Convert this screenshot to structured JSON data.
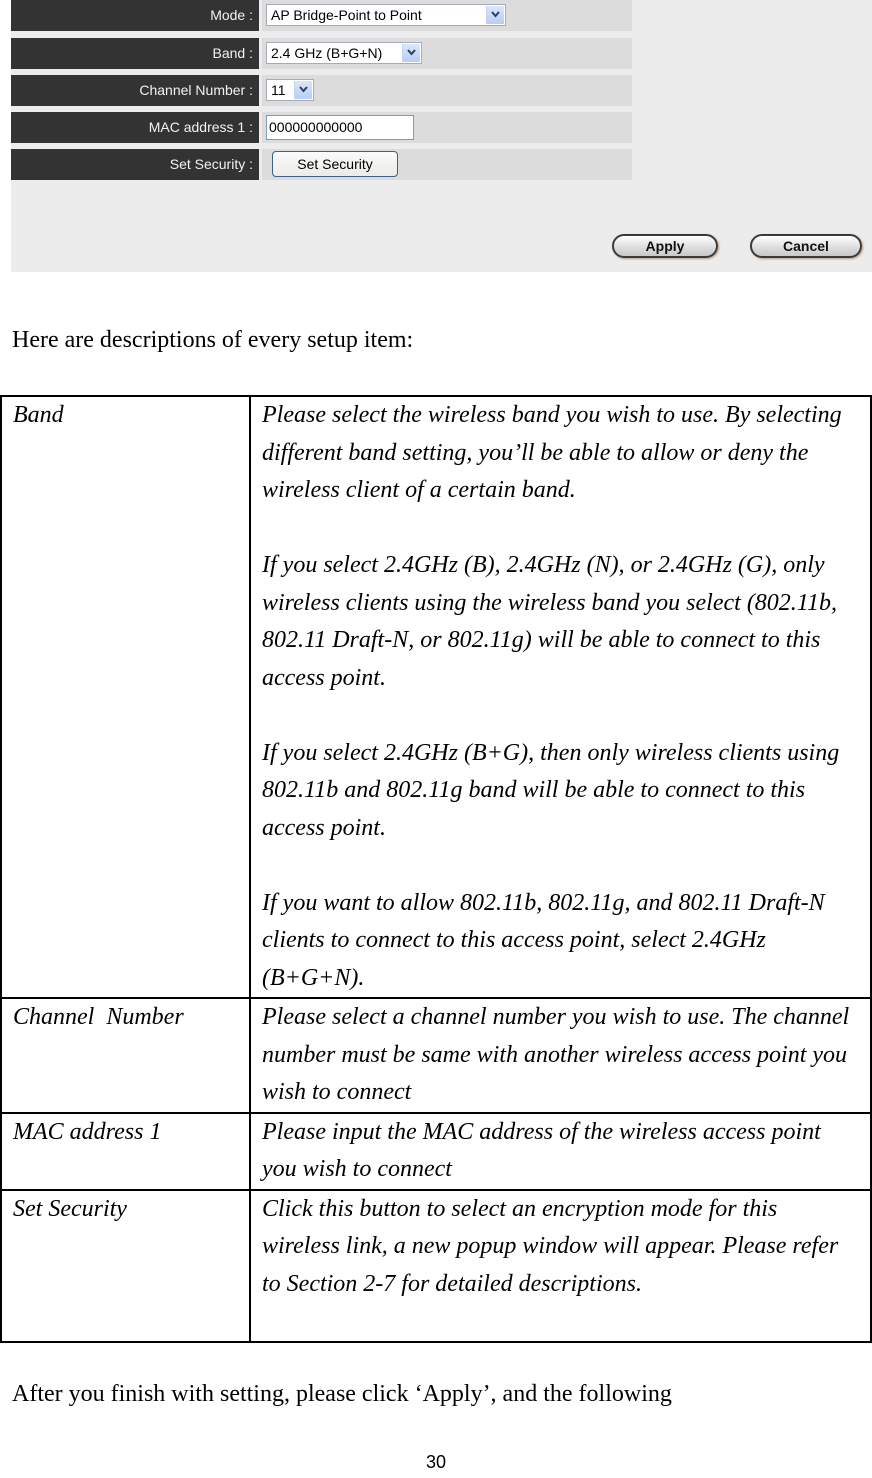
{
  "ui_screenshot": {
    "fields": [
      {
        "label": "Mode :",
        "type": "select",
        "value": "AP Bridge-Point to Point"
      },
      {
        "label": "Band :",
        "type": "select",
        "value": "2.4 GHz (B+G+N)"
      },
      {
        "label": "Channel Number :",
        "type": "select",
        "value": "11"
      },
      {
        "label": "MAC address 1 :",
        "type": "text",
        "value": "000000000000"
      },
      {
        "label": "Set Security :",
        "type": "button",
        "value": "Set Security"
      }
    ],
    "apply_label": "Apply",
    "cancel_label": "Cancel",
    "colors": {
      "label_bg": "#333333",
      "value_bg": "#dcdcdc",
      "panel_bg": "#ececec"
    }
  },
  "intro": "Here are descriptions of every setup item:",
  "table": [
    {
      "term": "Band",
      "paragraphs": [
        "Please select the wireless band you wish to use. By selecting different band setting, you’ll be able to allow or deny the wireless client of a certain band.",
        "If you select 2.4GHz (B), 2.4GHz (N), or 2.4GHz (G), only wireless clients using the wireless band you select (802.11b, 802.11 Draft-N, or 802.11g) will be able to connect to this access point.",
        "If you select 2.4GHz (B+G), then only wireless clients using 802.11b and 802.11g band will be able to connect to this access point.",
        "If you want to allow 802.11b, 802.11g, and 802.11 Draft-N clients to connect to this access point, select 2.4GHz (B+G+N)."
      ]
    },
    {
      "term": "Channel  Number",
      "paragraphs": [
        "Please select a channel number you wish to use. The channel number must be same with another wireless access point you wish to connect"
      ]
    },
    {
      "term": "MAC address 1",
      "paragraphs": [
        "Please input the MAC address of the wireless access point you wish to connect"
      ]
    },
    {
      "term": "Set Security",
      "paragraphs": [
        "Click this button to select an encryption mode for this wireless link, a new popup window will appear. Please refer to Section 2-7 for detailed descriptions."
      ]
    }
  ],
  "outro": "After you finish with setting, please click ‘Apply’, and the following",
  "page_number": "30"
}
